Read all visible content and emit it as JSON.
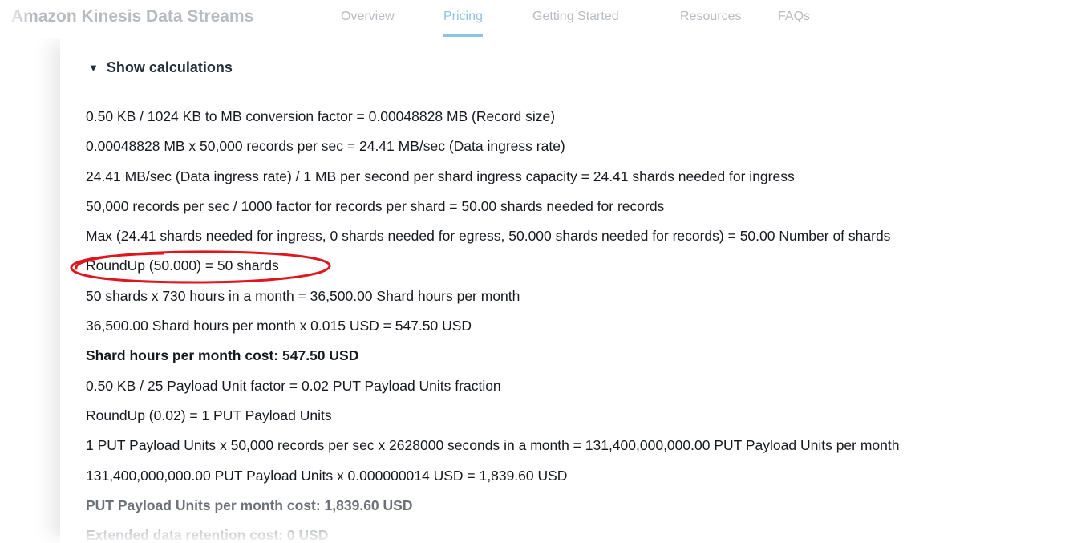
{
  "nav": {
    "brand": "Amazon Kinesis Data Streams",
    "tabs": [
      {
        "label": "Overview",
        "active": false
      },
      {
        "label": "Pricing",
        "active": true
      },
      {
        "label": "Getting Started",
        "active": false
      },
      {
        "label": "Resources",
        "active": false
      },
      {
        "label": "FAQs",
        "active": false
      }
    ]
  },
  "calculations": {
    "toggle_label": "Show calculations",
    "toggle_icon": "caret-down-icon",
    "lines": [
      "0.50 KB / 1024 KB to MB conversion factor = 0.00048828 MB (Record size)",
      "0.00048828 MB x 50,000 records per sec = 24.41 MB/sec (Data ingress rate)",
      "24.41 MB/sec (Data ingress rate) / 1 MB per second per shard ingress capacity = 24.41 shards needed for ingress",
      "50,000 records per sec / 1000 factor for records per shard = 50.00 shards needed for records",
      "Max (24.41 shards needed for ingress, 0 shards needed for egress, 50.000 shards needed for records) = 50.00 Number of shards",
      "RoundUp (50.000) = 50 shards",
      "50 shards x 730 hours in a month = 36,500.00 Shard hours per month",
      "36,500.00 Shard hours per month x 0.015 USD = 547.50 USD",
      "Shard hours per month cost: 547.50 USD",
      "0.50 KB / 25 Payload Unit factor = 0.02 PUT Payload Units fraction",
      "RoundUp (0.02) = 1 PUT Payload Units",
      "1 PUT Payload Units x 50,000 records per sec x 2628000 seconds in a month = 131,400,000,000.00 PUT Payload Units per month",
      "131,400,000,000.00 PUT Payload Units x 0.000000014 USD = 1,839.60 USD",
      "PUT Payload Units per month cost: 1,839.60 USD",
      "Extended data retention cost: 0 USD"
    ]
  },
  "annotation": {
    "color": "#e0161f",
    "highlighted_line": "RoundUp (50.000) = 50 shards"
  },
  "colors": {
    "active_tab": "#8fc3e6",
    "text": "#16191f"
  }
}
